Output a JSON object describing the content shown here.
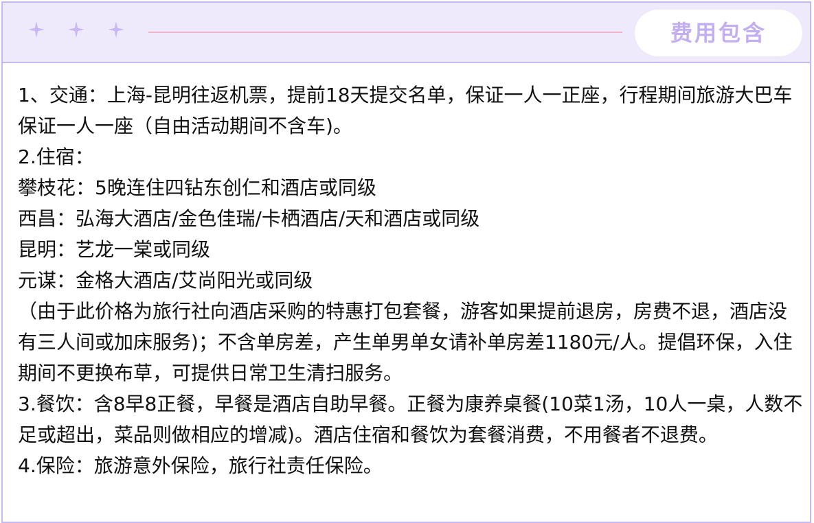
{
  "header": {
    "title": "费用包含",
    "decorations": [
      "sparkle-icon",
      "sparkle-icon",
      "sparkle-icon"
    ],
    "colors": {
      "header_bg": "#eeeafb",
      "border": "#c7b9f0",
      "title_text": "#c2aef1",
      "divider": "#f2b5cd",
      "sparkle": "#c9b8f3"
    }
  },
  "content": {
    "paragraphs": [
      "1、交通：上海-昆明往返机票，提前18天提交名单，保证一人一正座，行程期间旅游大巴车保证一人一座（自由活动期间不含车)。",
      "2.住宿：",
      "攀枝花：5晚连住四钻东创仁和酒店或同级",
      "西昌：弘海大酒店/金色佳瑞/卡栖酒店/天和酒店或同级",
      "昆明：艺龙一棠或同级",
      "元谋：金格大酒店/艾尚阳光或同级",
      "（由于此价格为旅行社向酒店采购的特惠打包套餐，游客如果提前退房，房费不退，酒店没有三人间或加床服务)；不含单房差，产生单男单女请补单房差1180元/人。提倡环保，入住期间不更换布草，可提供日常卫生清扫服务。",
      "3.餐饮：含8早8正餐，早餐是酒店自助早餐。正餐为康养桌餐(10菜1汤，10人一桌，人数不足或超出，菜品则做相应的增减)。酒店住宿和餐饮为套餐消费，不用餐者不退费。",
      "4.保险：旅游意外保险，旅行社责任保险。"
    ]
  }
}
